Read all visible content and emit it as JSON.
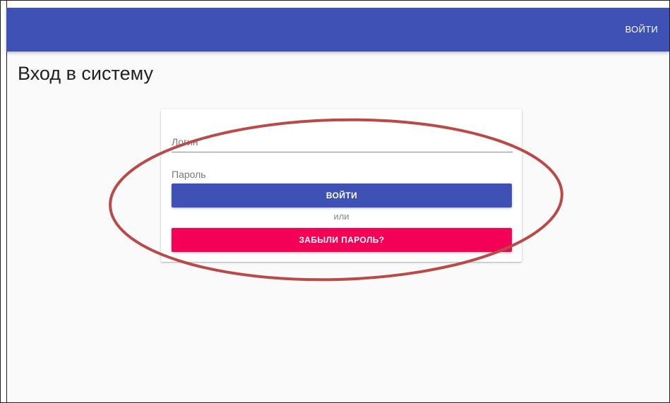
{
  "header": {
    "login_link": "ВОЙТИ",
    "bg_color": "#3f51b5"
  },
  "page": {
    "title": "Вход в систему"
  },
  "form": {
    "login_label": "Логин",
    "password_label": "Пароль",
    "submit_label": "ВОЙТИ",
    "or_text": "или",
    "forgot_label": "ЗАБЫЛИ ПАРОЛЬ?",
    "submit_color": "#3f51b5",
    "forgot_color": "#f50057"
  },
  "annotation": {
    "shape": "ellipse",
    "color": "#b94a48"
  }
}
